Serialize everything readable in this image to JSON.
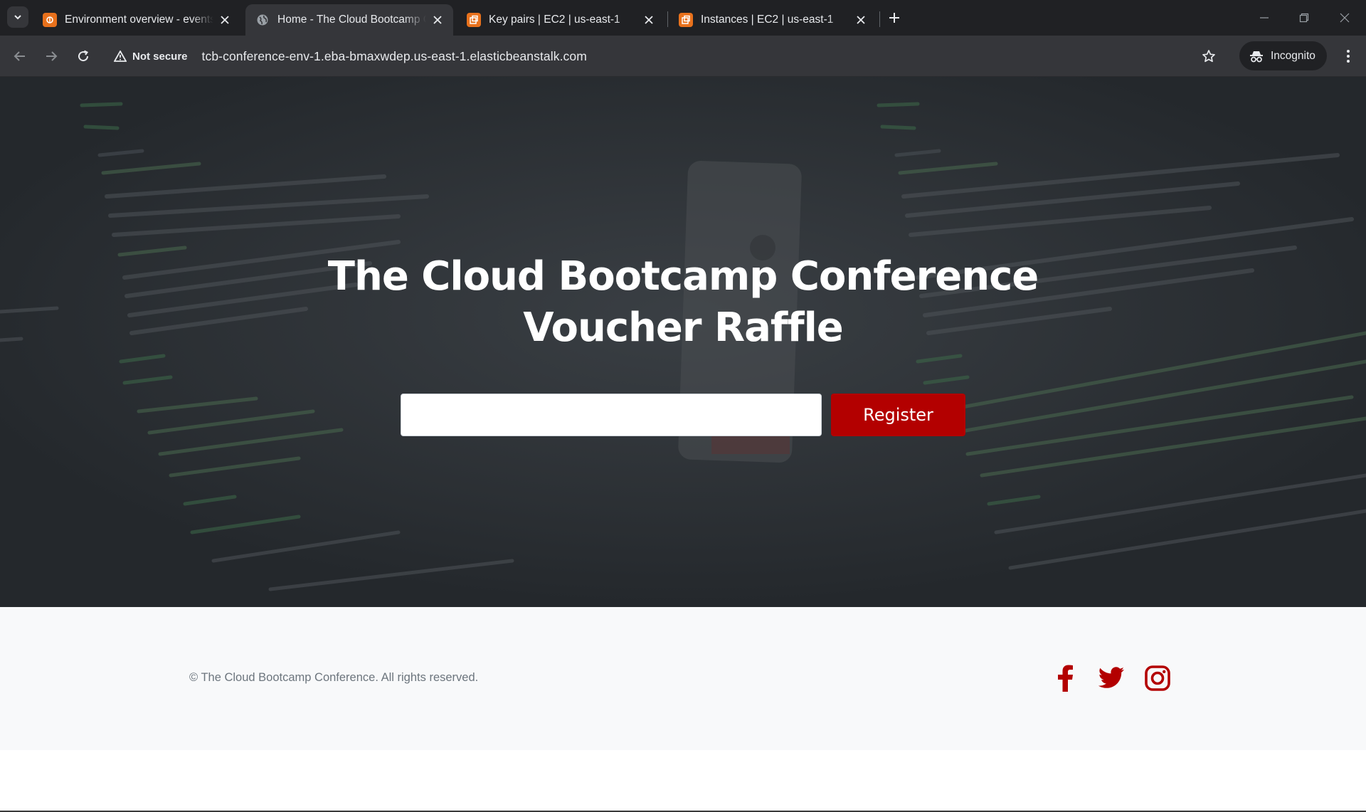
{
  "browser": {
    "tabs": [
      {
        "title": "Environment overview - events",
        "favicon": "aws-elastic-beanstalk-icon",
        "active": false
      },
      {
        "title": "Home - The Cloud Bootcamp Conference",
        "favicon": "globe-icon",
        "active": true
      },
      {
        "title": "Key pairs | EC2 | us-east-1",
        "favicon": "aws-ec2-icon",
        "active": false
      },
      {
        "title": "Instances | EC2 | us-east-1",
        "favicon": "aws-ec2-icon",
        "active": false
      }
    ],
    "security_label": "Not secure",
    "url": "tcb-conference-env-1.eba-bmaxwdep.us-east-1.elasticbeanstalk.com",
    "profile_label": "Incognito"
  },
  "page": {
    "title_line1": "The Cloud Bootcamp Conference",
    "title_line2": "Voucher Raffle",
    "email_value": "",
    "register_label": "Register",
    "copyright": "© The Cloud Bootcamp Conference. All rights reserved.",
    "social_icons": [
      "facebook-icon",
      "twitter-icon",
      "instagram-icon"
    ]
  },
  "colors": {
    "accent": "#b30000",
    "hero_bg": "#2c3034",
    "footer_bg": "#f8f9fa",
    "chrome_dark": "#202124",
    "chrome_toolbar": "#35363a"
  }
}
